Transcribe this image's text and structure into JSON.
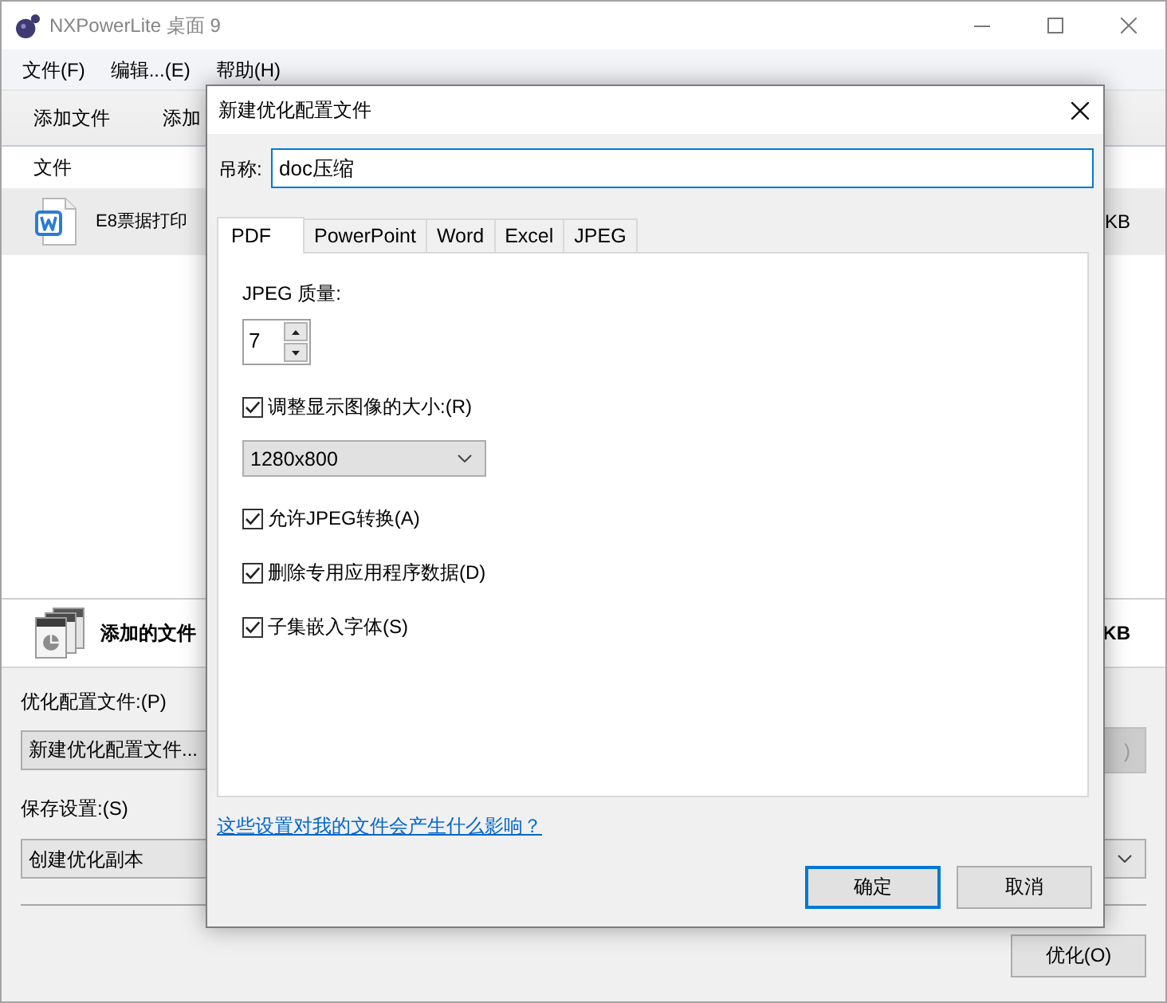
{
  "window": {
    "title": "NXPowerLite 桌面 9"
  },
  "menu": [
    "文件(F)",
    "编辑...(E)",
    "帮助(H)"
  ],
  "toolbar": [
    "添加文件",
    "添加"
  ],
  "file_list": {
    "columns": [
      "文件"
    ],
    "rows": [
      {
        "name": "E8票据打印",
        "size": "KB",
        "selected": true
      }
    ]
  },
  "summary": {
    "label": "添加的文件",
    "size": "KB"
  },
  "profile": {
    "label": "优化配置文件:(P)",
    "value": "新建优化配置文件...",
    "button": {
      "label": ")",
      "disabled": true
    }
  },
  "save": {
    "label": "保存设置:(S)",
    "value": "创建优化副本"
  },
  "optimize_button": {
    "label": "优化(O)"
  },
  "dialog": {
    "title": "新建优化配置文件",
    "name_label": "吊称:",
    "name_value": "doc压缩",
    "tabs": [
      {
        "label": "PDF",
        "selected": true
      },
      {
        "label": "PowerPoint",
        "selected": false
      },
      {
        "label": "Word",
        "selected": false
      },
      {
        "label": "Excel",
        "selected": false
      },
      {
        "label": "JPEG",
        "selected": false
      }
    ],
    "settings": [
      {
        "kind": "spinner",
        "label": "JPEG 质量:",
        "value": "7"
      },
      {
        "kind": "checkbox",
        "label": "调整显示图像的大小:(R)",
        "checked": true
      },
      {
        "kind": "select",
        "value": "1280x800"
      },
      {
        "kind": "checkbox",
        "label": "允许JPEG转换(A)",
        "checked": true
      },
      {
        "kind": "checkbox",
        "label": "删除专用应用程序数据(D)",
        "checked": true
      },
      {
        "kind": "checkbox",
        "label": "子集嵌入字体(S)",
        "checked": true
      }
    ],
    "help_link": "这些设置对我的文件会产生什么影响？",
    "buttons": [
      {
        "label": "确定",
        "default": true
      },
      {
        "label": "取消",
        "default": false
      }
    ]
  }
}
